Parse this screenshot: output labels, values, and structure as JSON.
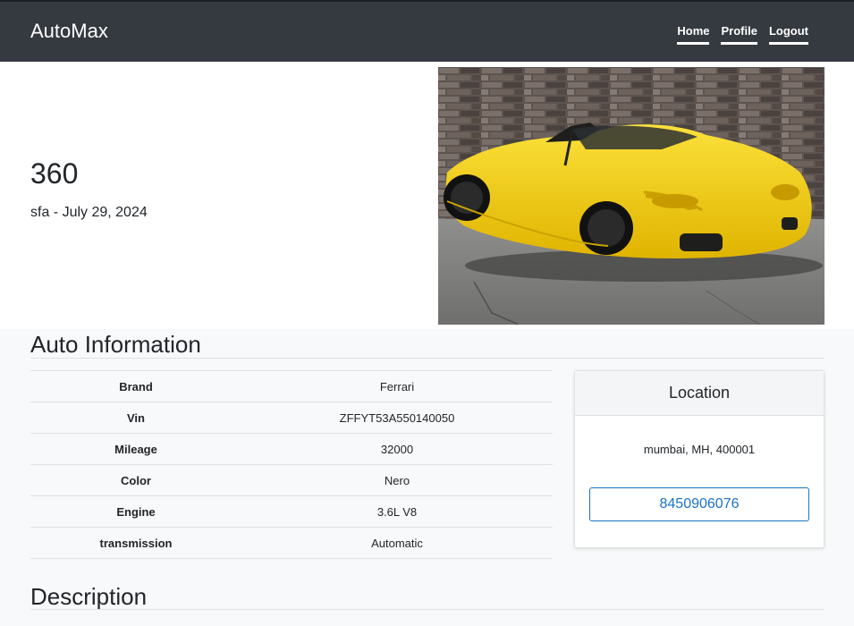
{
  "nav": {
    "brand": "AutoMax",
    "links": [
      "Home",
      "Profile",
      "Logout"
    ]
  },
  "listing": {
    "title": "360",
    "subtitle": "sfa - July 29, 2024",
    "image_alt": "yellow-convertible-sports-car-photo"
  },
  "info": {
    "heading": "Auto Information",
    "rows": [
      {
        "label": "Brand",
        "value": "Ferrari"
      },
      {
        "label": "Vin",
        "value": "ZFFYT53A550140050"
      },
      {
        "label": "Mileage",
        "value": "32000"
      },
      {
        "label": "Color",
        "value": "Nero"
      },
      {
        "label": "Engine",
        "value": "3.6L V8"
      },
      {
        "label": "transmission",
        "value": "Automatic"
      }
    ]
  },
  "location": {
    "heading": "Location",
    "address": "mumbai, MH, 400001",
    "phone": "8450906076"
  },
  "description": {
    "heading": "Description"
  },
  "colors": {
    "navbar": "#343a40",
    "accent": "#1a73c8",
    "car": "#f5cf1a"
  }
}
